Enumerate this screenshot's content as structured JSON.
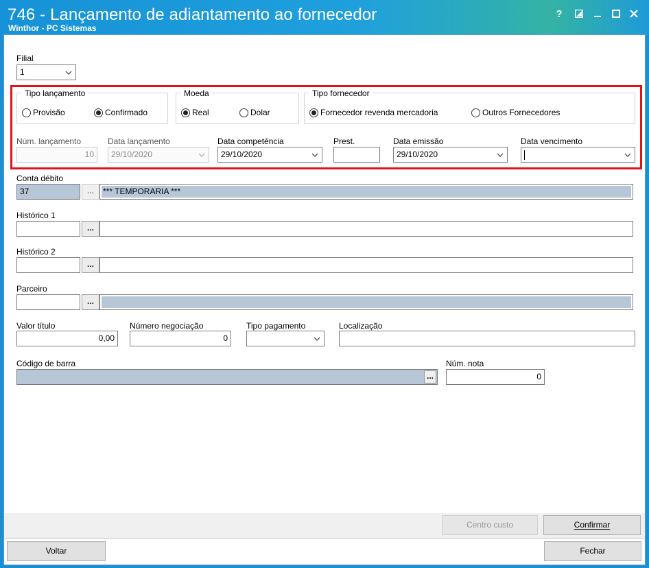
{
  "window": {
    "title": "746 - Lançamento de adiantamento ao fornecedor",
    "subtitle": "Winthor - PC Sistemas",
    "controls": {
      "help": "?",
      "minimize": "–",
      "maximize": "☐",
      "close": "✕"
    }
  },
  "filial": {
    "label": "Filial",
    "value": "1"
  },
  "tipo_lancamento": {
    "title": "Tipo lançamento",
    "options": [
      {
        "label": "Provisão",
        "selected": false
      },
      {
        "label": "Confirmado",
        "selected": true
      }
    ]
  },
  "moeda": {
    "title": "Moeda",
    "options": [
      {
        "label": "Real",
        "selected": true
      },
      {
        "label": "Dolar",
        "selected": false
      }
    ]
  },
  "tipo_fornecedor": {
    "title": "Tipo fornecedor",
    "options": [
      {
        "label": "Fornecedor revenda mercadoria",
        "selected": true
      },
      {
        "label": "Outros Fornecedores",
        "selected": false
      }
    ]
  },
  "num_lancamento": {
    "label": "Núm. lançamento",
    "value": "10"
  },
  "data_lancamento": {
    "label": "Data lançamento",
    "value": "29/10/2020"
  },
  "data_competencia": {
    "label": "Data competência",
    "value": "29/10/2020"
  },
  "prest": {
    "label": "Prest.",
    "value": ""
  },
  "data_emissao": {
    "label": "Data emissão",
    "value": "29/10/2020"
  },
  "data_vencimento": {
    "label": "Data vencimento",
    "value": ""
  },
  "conta_debito": {
    "label": "Conta débito",
    "code": "37",
    "description": "*** TEMPORARIA ***",
    "lookup": "..."
  },
  "historico1": {
    "label": "Histórico 1",
    "code": "",
    "description": "",
    "lookup": "..."
  },
  "historico2": {
    "label": "Histórico 2",
    "code": "",
    "description": "",
    "lookup": "..."
  },
  "parceiro": {
    "label": "Parceiro",
    "code": "",
    "description": "",
    "lookup": "..."
  },
  "valor_titulo": {
    "label": "Valor título",
    "value": "0,00"
  },
  "numero_negociacao": {
    "label": "Número negociação",
    "value": "0"
  },
  "tipo_pagamento": {
    "label": "Tipo pagamento",
    "value": ""
  },
  "localizacao": {
    "label": "Localização",
    "value": ""
  },
  "codigo_barra": {
    "label": "Código de barra",
    "value": "",
    "lookup": "..."
  },
  "num_nota": {
    "label": "Núm. nota",
    "value": "0"
  },
  "buttons": {
    "centro_custo": "Centro custo",
    "confirmar": "Confirmar",
    "voltar": "Voltar",
    "fechar": "Fechar"
  },
  "colors": {
    "highlight": "#e0111a",
    "titlebar": "#1c8fd3",
    "readonly_fill": "#b7c7d8"
  }
}
